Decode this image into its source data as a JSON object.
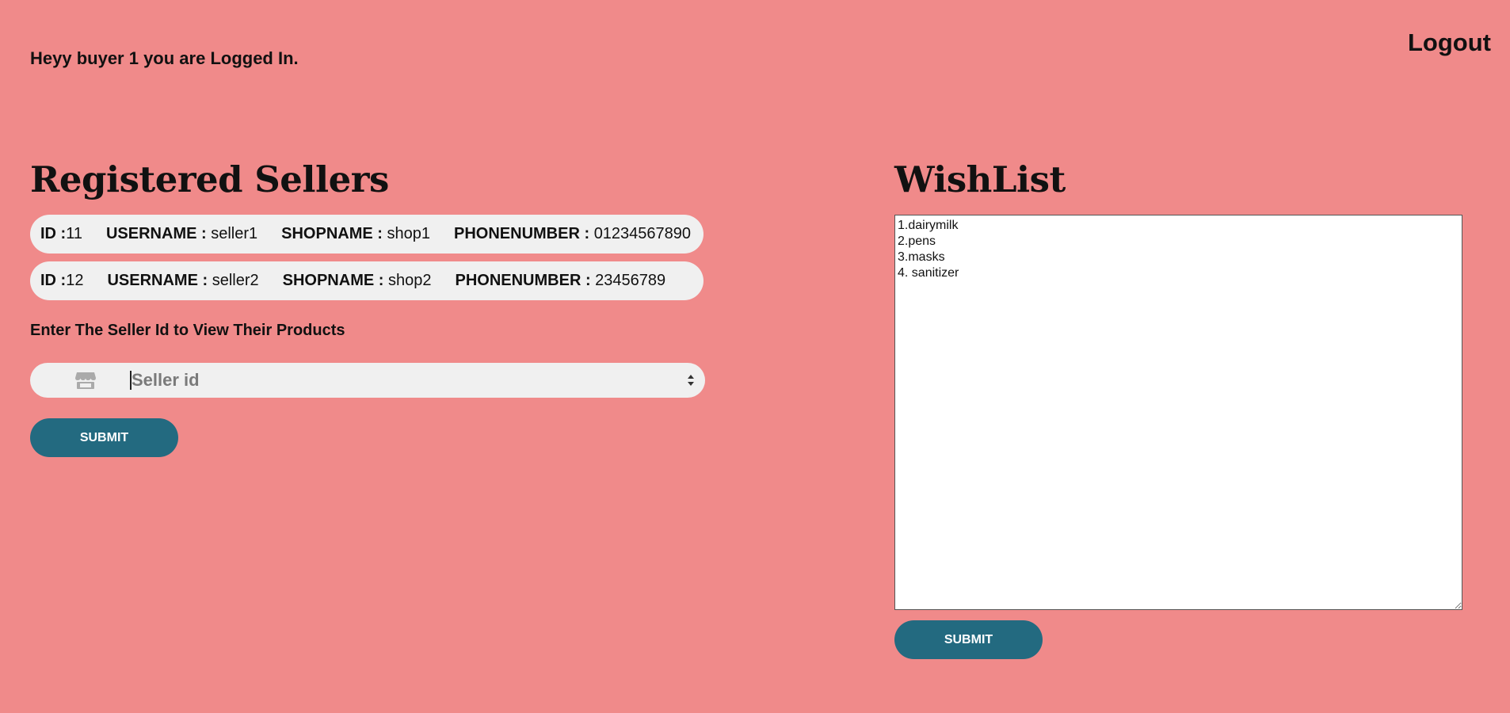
{
  "header": {
    "welcome_text": "Heyy buyer 1 you are Logged In.",
    "logout_label": "Logout"
  },
  "sellers": {
    "title": "Registered Sellers",
    "items": [
      {
        "id_label": "ID :",
        "id": "11",
        "username_label": "USERNAME :",
        "username": "seller1",
        "shopname_label": "SHOPNAME :",
        "shopname": "shop1",
        "phone_label": "PHONENUMBER :",
        "phone": "01234567890"
      },
      {
        "id_label": "ID :",
        "id": "12",
        "username_label": "USERNAME :",
        "username": "seller2",
        "shopname_label": "SHOPNAME :",
        "shopname": "shop2",
        "phone_label": "PHONENUMBER :",
        "phone": "23456789"
      }
    ],
    "prompt": "Enter The Seller Id to View Their Products",
    "input_placeholder": "Seller id",
    "input_icon": "store-icon",
    "submit_label": "SUBMIT"
  },
  "wishlist": {
    "title": "WishList",
    "content": "1.dairymilk\n2.pens\n3.masks\n4. sanitizer",
    "submit_label": "SUBMIT"
  },
  "colors": {
    "background": "#f08a8a",
    "button": "#236a80",
    "card": "#f0f0f0"
  }
}
